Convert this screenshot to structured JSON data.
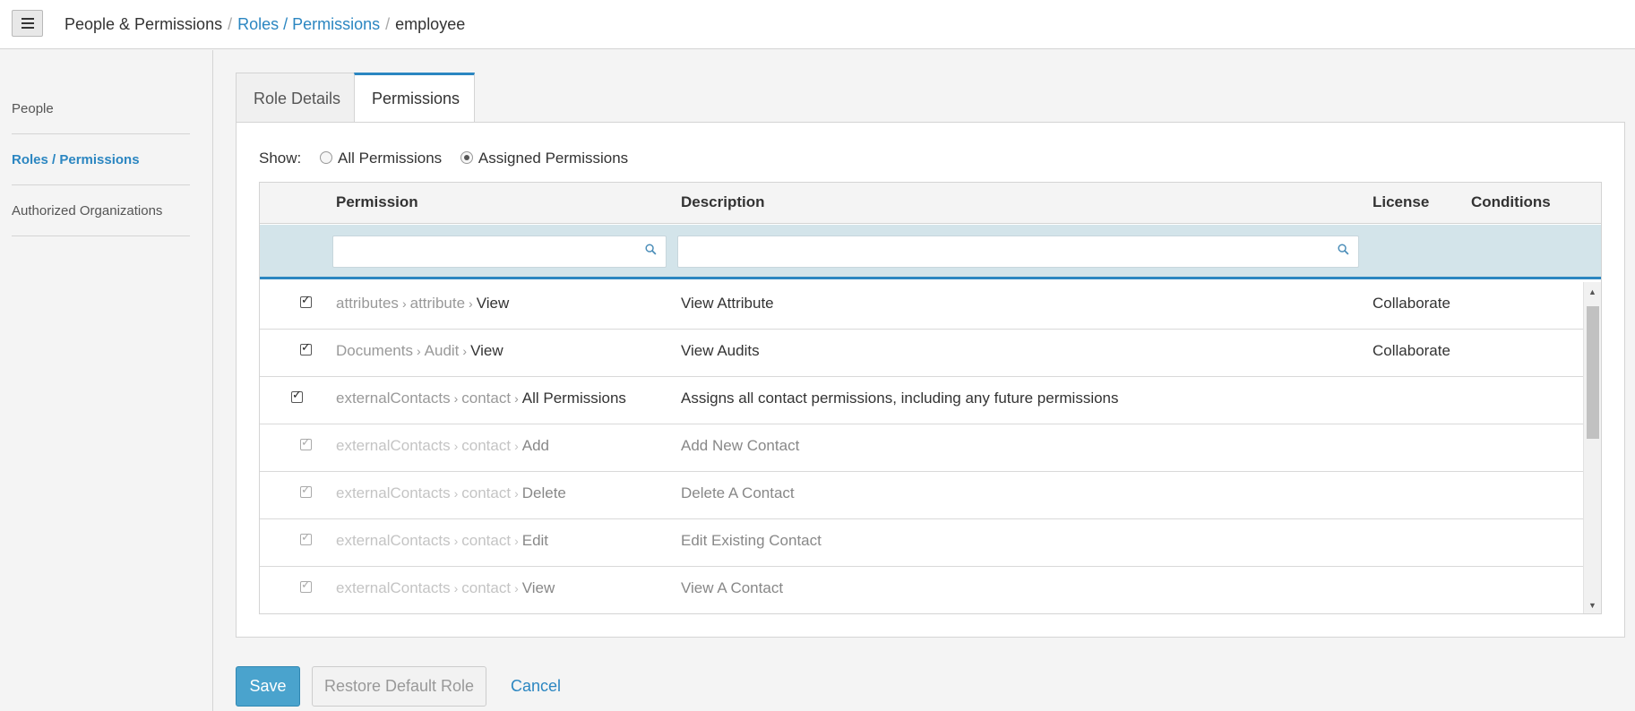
{
  "header": {
    "breadcrumb": [
      "People & Permissions",
      "Roles / Permissions",
      "employee"
    ],
    "separator": "/"
  },
  "sidebar": {
    "items": [
      {
        "label": "People"
      },
      {
        "label": "Roles / Permissions",
        "active": true
      },
      {
        "label": "Authorized Organizations"
      }
    ]
  },
  "tabs": [
    {
      "label": "Role Details"
    },
    {
      "label": "Permissions",
      "active": true
    }
  ],
  "filter": {
    "show_label": "Show:",
    "options": [
      "All Permissions",
      "Assigned Permissions"
    ],
    "selected": "Assigned Permissions"
  },
  "grid": {
    "columns": [
      "Permission",
      "Description",
      "License",
      "Conditions"
    ],
    "permission_filter_value": "",
    "description_filter_value": "",
    "rows": [
      {
        "checked": true,
        "enabled": true,
        "path": [
          "attributes",
          "attribute"
        ],
        "leaf": "View",
        "description": "View Attribute",
        "license": "Collaborate",
        "conditions": ""
      },
      {
        "checked": true,
        "enabled": true,
        "path": [
          "Documents",
          "Audit"
        ],
        "leaf": "View",
        "description": "View Audits",
        "license": "Collaborate",
        "conditions": ""
      },
      {
        "checked": true,
        "enabled": true,
        "path": [
          "externalContacts",
          "contact"
        ],
        "leaf": "All Permissions",
        "description": "Assigns all contact permissions, including any future permissions",
        "license": "",
        "conditions": ""
      },
      {
        "checked": true,
        "enabled": false,
        "path": [
          "externalContacts",
          "contact"
        ],
        "leaf": "Add",
        "description": "Add New Contact",
        "license": "",
        "conditions": ""
      },
      {
        "checked": true,
        "enabled": false,
        "path": [
          "externalContacts",
          "contact"
        ],
        "leaf": "Delete",
        "description": "Delete A Contact",
        "license": "",
        "conditions": ""
      },
      {
        "checked": true,
        "enabled": false,
        "path": [
          "externalContacts",
          "contact"
        ],
        "leaf": "Edit",
        "description": "Edit Existing Contact",
        "license": "",
        "conditions": ""
      },
      {
        "checked": true,
        "enabled": false,
        "path": [
          "externalContacts",
          "contact"
        ],
        "leaf": "View",
        "description": "View A Contact",
        "license": "",
        "conditions": ""
      }
    ]
  },
  "actions": {
    "save": "Save",
    "restore": "Restore Default Role",
    "cancel": "Cancel"
  },
  "colors": {
    "accent": "#2b86c1",
    "save_button": "#4aa3cd",
    "filter_row": "#d3e4ea"
  },
  "icons": {
    "menu": "hamburger-icon",
    "search": "search-icon",
    "chevron": "chevron-right-icon"
  }
}
